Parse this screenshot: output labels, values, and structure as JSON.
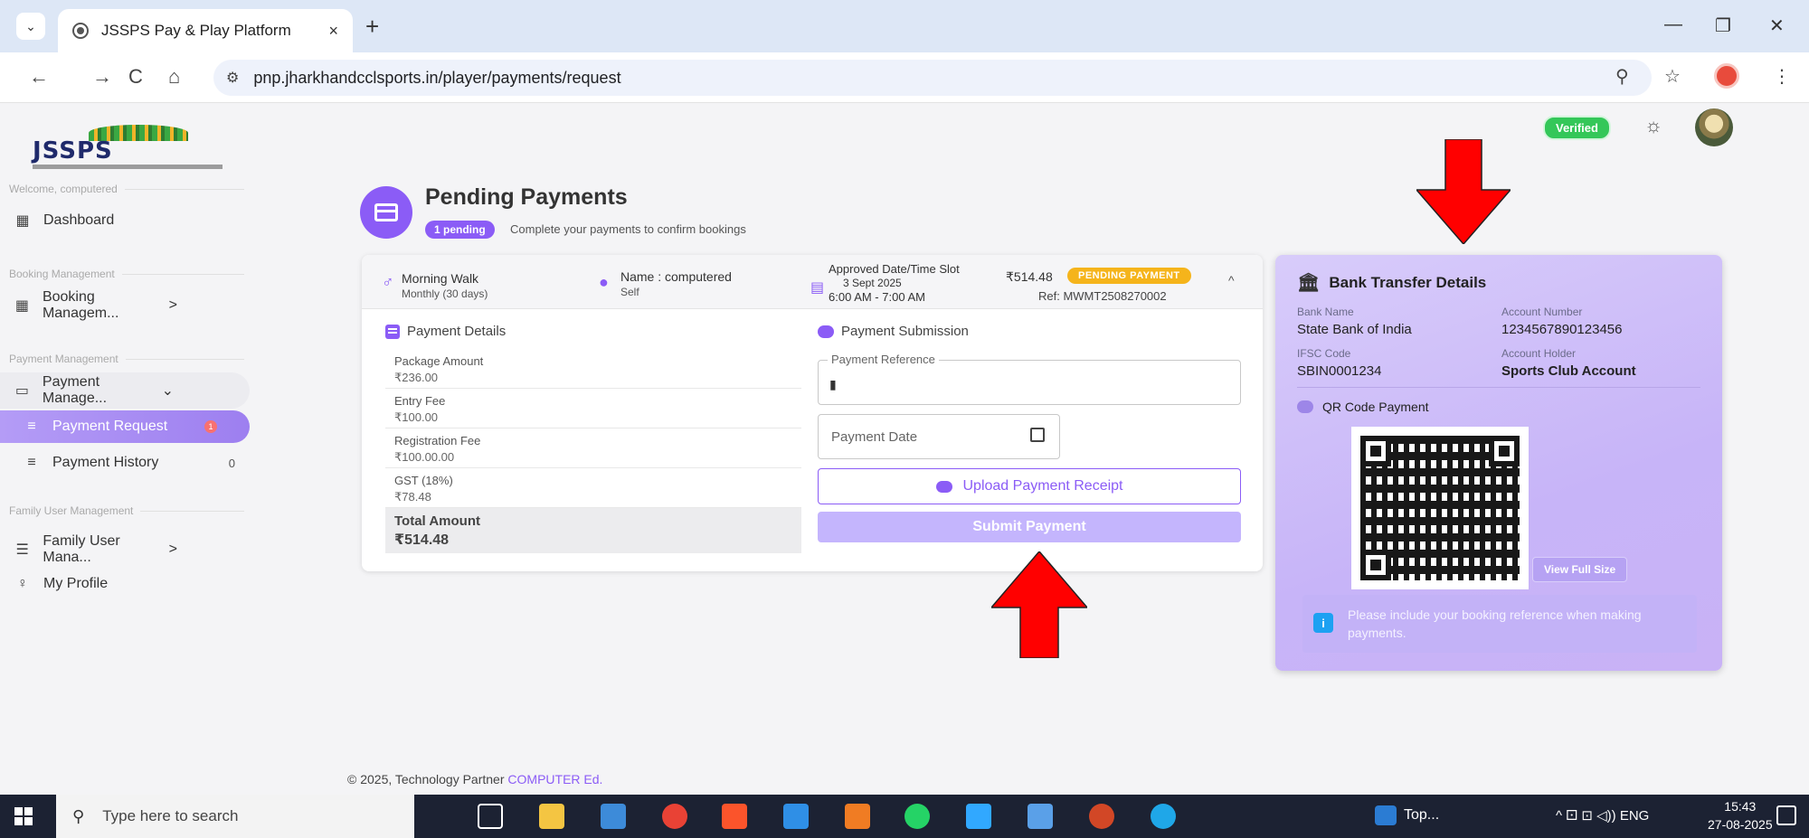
{
  "browser": {
    "tab_title": "JSSPS Pay & Play Platform",
    "tab_close": "×",
    "new_tab": "+",
    "url": "pnp.jharkhandcclsports.in/player/payments/request",
    "back": "←",
    "forward": "→",
    "reload": "C",
    "home": "⌂",
    "zoom": "⚲",
    "bookmark": "☆",
    "menu": "⋮",
    "minimize": "—",
    "maximize": "❐",
    "close": "✕",
    "tab_menu": "⌄"
  },
  "logo": {
    "text": "JSSPS"
  },
  "sidebar": {
    "welcome": "Welcome, computered",
    "dashboard": "Dashboard",
    "section_booking": "Booking Management",
    "booking": "Booking Managem...",
    "section_payment": "Payment Management",
    "payment": "Payment Manage...",
    "payment_request": "Payment Request",
    "payment_request_badge": "1",
    "payment_history": "Payment History",
    "payment_history_count": "0",
    "section_family": "Family User Management",
    "family": "Family User Mana...",
    "profile": "My Profile",
    "chev_right": ">",
    "chev_down": "⌄",
    "sub_bullet": "≡"
  },
  "header": {
    "verified": "Verified",
    "theme_icon": "☼"
  },
  "page": {
    "title": "Pending Payments",
    "pending_badge": "1 pending",
    "subtitle": "Complete your payments to confirm bookings"
  },
  "booking": {
    "activity": "Morning Walk",
    "plan": "Monthly (30 days)",
    "name": "Name : computered",
    "relation": "Self",
    "slot_label": "Approved Date/Time Slot",
    "date": "3 Sept 2025",
    "time": "6:00 AM - 7:00 AM",
    "amount": "₹514.48",
    "status": "PENDING PAYMENT",
    "ref": "Ref: MWMT2508270002",
    "expand": "^"
  },
  "payment_details": {
    "title": "Payment Details",
    "rows": [
      {
        "label": "Package Amount",
        "value": "₹236.00"
      },
      {
        "label": "Entry Fee",
        "value": "₹100.00"
      },
      {
        "label": "Registration Fee",
        "value": "₹100.00.00"
      },
      {
        "label": "GST (18%)",
        "value": "₹78.48"
      }
    ],
    "total_label": "Total Amount",
    "total_value": "₹514.48"
  },
  "submission": {
    "title": "Payment Submission",
    "ref_legend": "Payment Reference",
    "ref_icon": "▮",
    "date_placeholder": "Payment Date",
    "upload": "Upload Payment Receipt",
    "submit": "Submit Payment"
  },
  "bank": {
    "title": "Bank Transfer Details",
    "bank_icon": "🏛",
    "bank_name_label": "Bank Name",
    "bank_name": "State Bank of India",
    "account_label": "Account Number",
    "account": "1234567890123456",
    "ifsc_label": "IFSC Code",
    "ifsc": "SBIN0001234",
    "holder_label": "Account Holder",
    "holder": "Sports Club Account",
    "qr_title": "QR Code Payment",
    "view_full": "View Full Size",
    "note": "Please include your booking reference when making payments.",
    "info_icon": "i"
  },
  "footer": {
    "prefix": "© 2025, Technology Partner",
    "partner": "COMPUTER Ed."
  },
  "taskbar": {
    "search": "Type here to search",
    "search_icon": "⚲",
    "top_app": "Top...",
    "tray": "^  ⚀  ⊡  ◁))  ENG",
    "time": "15:43",
    "date": "27-08-2025"
  },
  "colors": {
    "accent": "#8b5cf6",
    "status_pending": "#f5b41b",
    "verified": "#34c759",
    "arrow": "#ff0000"
  }
}
